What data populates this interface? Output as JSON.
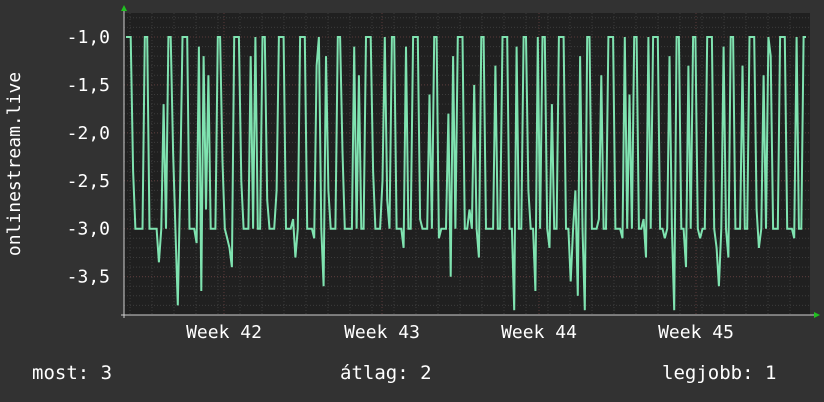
{
  "chart_data": {
    "type": "line",
    "ylabel": "onlinestream.live",
    "ylim": [
      -3.9,
      -0.75
    ],
    "y_ticks": [
      {
        "value": -1.0,
        "label": "-1,0"
      },
      {
        "value": -1.5,
        "label": "-1,5"
      },
      {
        "value": -2.0,
        "label": "-2,0"
      },
      {
        "value": -2.5,
        "label": "-2,5"
      },
      {
        "value": -3.0,
        "label": "-3,0"
      },
      {
        "value": -3.5,
        "label": "-3,5"
      }
    ],
    "x_ticks": [
      "Week 42",
      "Week 43",
      "Week 44",
      "Week 45"
    ],
    "grid": true,
    "series": [
      {
        "color": "#7fe3b0",
        "values": [
          -1,
          -1,
          -1,
          -2.4,
          -3,
          -3,
          -3,
          -3,
          -1,
          -1,
          -3,
          -3,
          -3,
          -3,
          -3.35,
          -3,
          -1.7,
          -3,
          -1,
          -1,
          -2.2,
          -3,
          -3.8,
          -2.6,
          -1,
          -1,
          -1,
          -3,
          -3,
          -3,
          -3.15,
          -1.1,
          -3.65,
          -1.2,
          -2.8,
          -1.4,
          -3,
          -3,
          -3,
          -1,
          -1,
          -2.3,
          -3,
          -3.1,
          -3.2,
          -3.4,
          -1,
          -1,
          -1,
          -2.5,
          -3,
          -3,
          -3,
          -1.2,
          -3,
          -1,
          -3,
          -3,
          -1,
          -1,
          -2.7,
          -3,
          -3,
          -3,
          -2.6,
          -1,
          -1,
          -1,
          -3,
          -3,
          -3,
          -2.9,
          -3.3,
          -3,
          -1,
          -1,
          -1,
          -3,
          -3,
          -3,
          -3.1,
          -1.3,
          -1,
          -3,
          -3.6,
          -1.2,
          -2.6,
          -3,
          -3,
          -3,
          -1,
          -1,
          -2.2,
          -3,
          -3,
          -3,
          -3,
          -1.1,
          -3,
          -1.4,
          -3,
          -3,
          -1,
          -1,
          -1,
          -2.4,
          -3,
          -3,
          -3,
          -2.5,
          -1,
          -2.7,
          -3,
          -1,
          -1,
          -3,
          -3,
          -3,
          -3.2,
          -1.1,
          -3,
          -3,
          -1,
          -1,
          -1,
          -2.9,
          -3,
          -3,
          -3,
          -1.6,
          -3,
          -1,
          -1,
          -3.1,
          -3,
          -3,
          -3,
          -1.8,
          -3.5,
          -1.2,
          -3,
          -1,
          -1,
          -1,
          -3,
          -3,
          -2.8,
          -3,
          -1.5,
          -3,
          -3.3,
          -1,
          -1,
          -3,
          -3,
          -3,
          -3,
          -1.3,
          -3,
          -3,
          -1,
          -1,
          -1,
          -3,
          -3,
          -3.85,
          -1.1,
          -3,
          -3,
          -1,
          -1,
          -2.6,
          -3,
          -3,
          -3.65,
          -1,
          -3,
          -1,
          -1,
          -3,
          -3.2,
          -1.7,
          -3,
          -3,
          -1,
          -1,
          -1,
          -3,
          -3,
          -3.55,
          -3,
          -2.6,
          -3.7,
          -1.2,
          -3,
          -3.85,
          -1,
          -1,
          -3,
          -3,
          -3,
          -2.9,
          -1.4,
          -3,
          -3,
          -1,
          -1,
          -1,
          -3,
          -3,
          -3,
          -3.1,
          -1,
          -3,
          -1.6,
          -3,
          -1,
          -1,
          -3,
          -3,
          -2.9,
          -3.3,
          -1,
          -3,
          -1,
          -1,
          -1,
          -3,
          -3,
          -3.1,
          -3,
          -1.2,
          -3,
          -3.85,
          -1,
          -1,
          -3,
          -3,
          -3.4,
          -1.3,
          -3,
          -1,
          -1,
          -3,
          -3.1,
          -3,
          -3,
          -1,
          -1,
          -1,
          -3,
          -3.2,
          -3.6,
          -3,
          -1.1,
          -3,
          -3.3,
          -1,
          -1,
          -3,
          -3,
          -3,
          -1.3,
          -3,
          -3,
          -1,
          -1,
          -1,
          -2.8,
          -3.2,
          -3,
          -1.4,
          -3,
          -1,
          -1.2,
          -3,
          -3,
          -3,
          -1,
          -1,
          -1,
          -3,
          -3,
          -3,
          -3.1,
          -1,
          -3,
          -3,
          -1,
          -1
        ]
      }
    ]
  },
  "legend": {
    "current": "most: 3",
    "average": "átlag: 2",
    "best": "legjobb: 1"
  }
}
